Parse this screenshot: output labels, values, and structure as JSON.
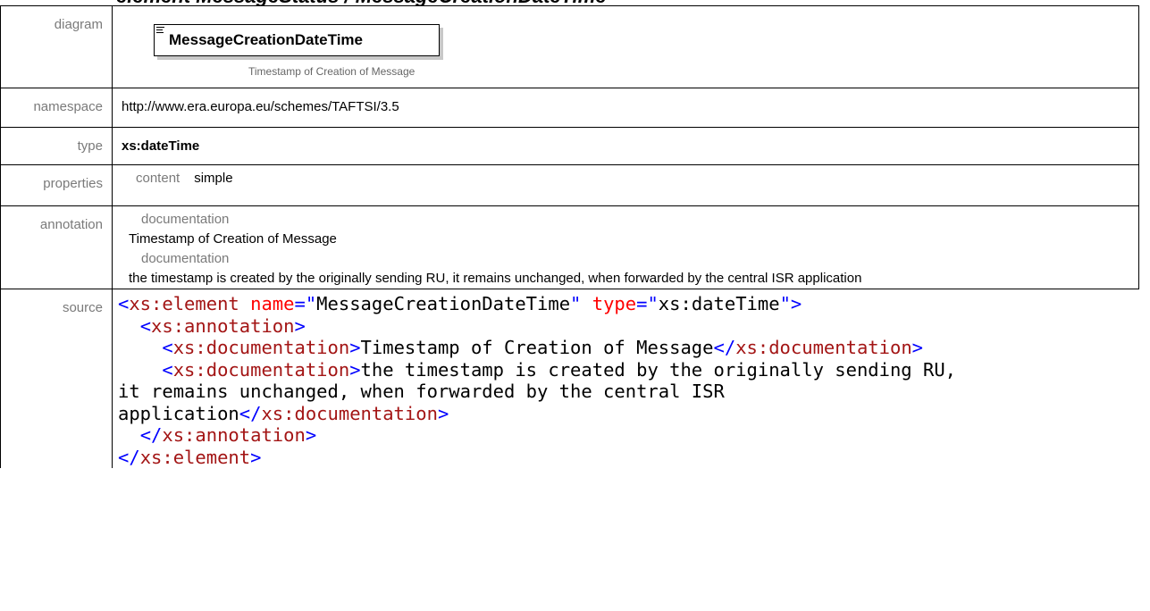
{
  "labels": {
    "diagram": "diagram",
    "namespace": "namespace",
    "type": "type",
    "properties": "properties",
    "annotation": "annotation",
    "source": "source"
  },
  "diagram": {
    "element_name": "MessageCreationDateTime",
    "documentation": "Timestamp of Creation of Message"
  },
  "namespace": "http://www.era.europa.eu/schemes/TAFTSI/3.5",
  "type": "xs:dateTime",
  "properties": {
    "key": "content",
    "value": "simple"
  },
  "annotation": {
    "entries": [
      {
        "heading": "documentation",
        "text": "Timestamp of Creation of Message"
      },
      {
        "heading": "documentation",
        "text": "the timestamp is created by the originally sending RU, it remains unchanged, when forwarded by the central ISR application"
      }
    ]
  },
  "source": {
    "elem_open": "xs:element",
    "attr_name": "name",
    "attr_name_val": "MessageCreationDateTime",
    "attr_type": "type",
    "attr_type_val": "xs:dateTime",
    "annotation_tag": "xs:annotation",
    "doc_tag": "xs:documentation",
    "doc1": "Timestamp of Creation of Message",
    "doc2_line1": "the timestamp is created by the originally sending RU,",
    "doc2_line2": "it remains unchanged, when forwarded by the central ISR",
    "doc2_line3": "application"
  },
  "colors": {
    "tag": "#a31515",
    "punct": "#0000ff",
    "attr": "#ff0000",
    "label": "#7a7a7a"
  }
}
